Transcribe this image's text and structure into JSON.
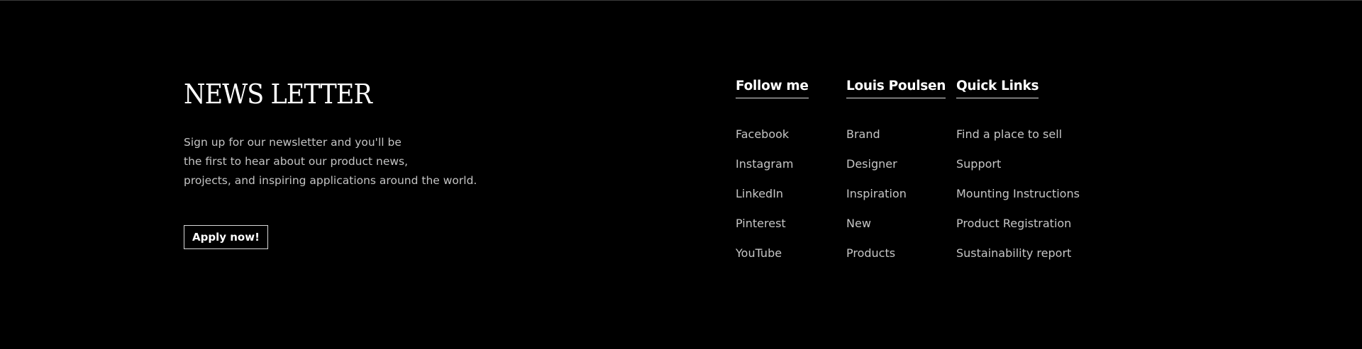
{
  "newsletter": {
    "title": "NEWS LETTER",
    "text_lines": [
      "Sign up for our newsletter and you'll be",
      "the first to hear about our product news,",
      "projects, and inspiring applications around the world."
    ],
    "button_label": "Apply now!"
  },
  "columns": {
    "follow": {
      "heading": "Follow me",
      "links": [
        "Facebook",
        "Instagram",
        "LinkedIn",
        "Pinterest",
        "YouTube"
      ]
    },
    "louis": {
      "heading": "Louis Poulsen",
      "links": [
        "Brand",
        "Designer",
        "Inspiration",
        "New",
        "Products"
      ]
    },
    "quick": {
      "heading": "Quick Links",
      "links": [
        "Find a place to sell",
        "Support",
        "Mounting Instructions",
        "Product Registration",
        "Sustainability report"
      ]
    }
  },
  "colors": {
    "background": "#000000",
    "heading": "#ffffff",
    "text": "#c6c6c6"
  }
}
